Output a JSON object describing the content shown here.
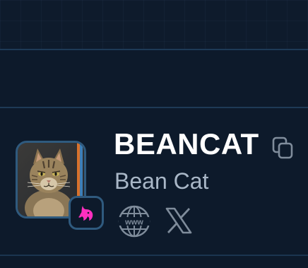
{
  "token": {
    "ticker": "BEANCAT",
    "name": "Bean Cat",
    "avatar_icon": "cat-photo",
    "chain_badge_icon": "uniswap-unicorn-icon"
  },
  "actions": {
    "copy_icon": "copy-icon",
    "website_icon": "globe-www-icon",
    "website_label": "www",
    "social_icon": "x-logo-icon"
  },
  "colors": {
    "background": "#0d1a2b",
    "divider": "#1e3a56",
    "badge_border": "#2f5a7e",
    "uniswap_pink": "#ff2fbf",
    "ticker_text": "#ffffff",
    "name_text": "#a9b7c7",
    "icon_grey": "#7f8c9b"
  }
}
